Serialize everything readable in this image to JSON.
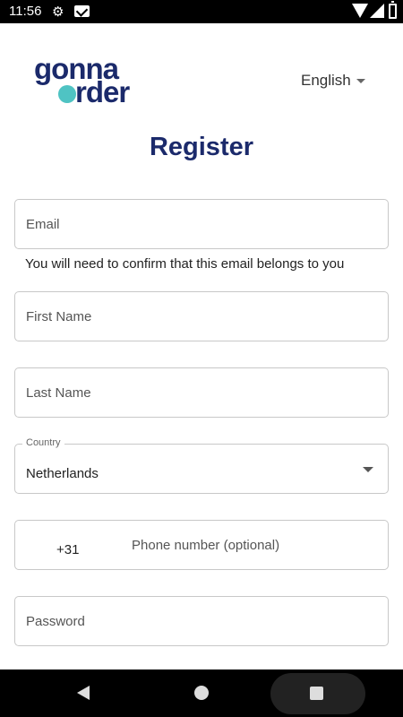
{
  "status_bar": {
    "time": "11:56"
  },
  "logo": {
    "line1": "gonna",
    "line2": "rder"
  },
  "language": {
    "label": "English"
  },
  "page": {
    "title": "Register"
  },
  "form": {
    "email_placeholder": "Email",
    "email_hint": "You will need to confirm that this email belongs to you",
    "first_name_placeholder": "First Name",
    "last_name_placeholder": "Last Name",
    "country_label": "Country",
    "country_value": "Netherlands",
    "phone_code": "+31",
    "phone_placeholder": "Phone number (optional)",
    "password_placeholder": "Password"
  },
  "icons": {
    "status": [
      "gear-icon",
      "mail-icon",
      "wifi-icon",
      "signal-icon",
      "battery-icon"
    ],
    "nav": [
      "back-icon",
      "home-icon",
      "recents-icon"
    ]
  },
  "colors": {
    "brand_navy": "#1b2a6b",
    "brand_teal": "#4fc3c3",
    "border": "#c8c8c8"
  }
}
